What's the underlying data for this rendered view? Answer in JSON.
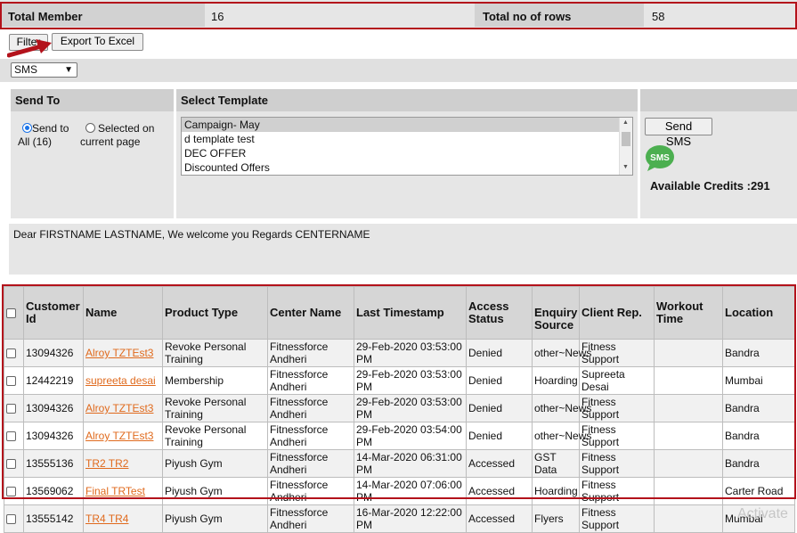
{
  "summary": {
    "total_member_label": "Total Member",
    "total_member_value": "16",
    "total_rows_label": "Total no of rows",
    "total_rows_value": "58"
  },
  "toolbar": {
    "filter_label": "Filter",
    "export_label": "Export To Excel"
  },
  "channel_select": {
    "value": "SMS"
  },
  "send_to": {
    "heading": "Send To",
    "option_all": "Send to All (16)",
    "option_selected": "Selected on current page",
    "selected": "all"
  },
  "template": {
    "heading": "Select Template",
    "options": [
      "Campaign- May",
      "d template test",
      "DEC OFFER",
      "Discounted Offers"
    ],
    "selected_index": 0
  },
  "sms_panel": {
    "send_label": "Send SMS",
    "icon_text": "SMS",
    "credits": "Available Credits :291"
  },
  "message": {
    "text": "Dear FIRSTNAME LASTNAME, We welcome you Regards CENTERNAME"
  },
  "table": {
    "headers": [
      "Customer Id",
      "Name",
      "Product Type",
      "Center Name",
      "Last Timestamp",
      "Access Status",
      "Enquiry Source",
      "Client Rep.",
      "Workout Time",
      "Location"
    ],
    "rows": [
      {
        "id": "13094326",
        "name": "Alroy TZTEst3",
        "product": "Revoke Personal Training",
        "center": "Fitnessforce Andheri",
        "timestamp": "29-Feb-2020 03:53:00 PM",
        "access": "Denied",
        "enquiry": "other~News",
        "rep": "Fitness Support",
        "workout": "",
        "location": "Bandra"
      },
      {
        "id": "12442219",
        "name": "supreeta desai",
        "product": "Membership",
        "center": "Fitnessforce Andheri",
        "timestamp": "29-Feb-2020 03:53:00 PM",
        "access": "Denied",
        "enquiry": "Hoarding",
        "rep": "Supreeta Desai",
        "workout": "",
        "location": "Mumbai"
      },
      {
        "id": "13094326",
        "name": "Alroy TZTEst3",
        "product": "Revoke Personal Training",
        "center": "Fitnessforce Andheri",
        "timestamp": "29-Feb-2020 03:53:00 PM",
        "access": "Denied",
        "enquiry": "other~News",
        "rep": "Fitness Support",
        "workout": "",
        "location": "Bandra"
      },
      {
        "id": "13094326",
        "name": "Alroy TZTEst3",
        "product": "Revoke Personal Training",
        "center": "Fitnessforce Andheri",
        "timestamp": "29-Feb-2020 03:54:00 PM",
        "access": "Denied",
        "enquiry": "other~News",
        "rep": "Fitness Support",
        "workout": "",
        "location": "Bandra"
      },
      {
        "id": "13555136",
        "name": "TR2 TR2",
        "product": "Piyush Gym",
        "center": "Fitnessforce Andheri",
        "timestamp": "14-Mar-2020 06:31:00 PM",
        "access": "Accessed",
        "enquiry": "GST Data",
        "rep": "Fitness Support",
        "workout": "",
        "location": "Bandra"
      },
      {
        "id": "13569062",
        "name": "Final TRTest",
        "product": "Piyush Gym",
        "center": "Fitnessforce Andheri",
        "timestamp": "14-Mar-2020 07:06:00 PM",
        "access": "Accessed",
        "enquiry": "Hoarding",
        "rep": "Fitness Support",
        "workout": "",
        "location": "Carter Road"
      },
      {
        "id": "13555142",
        "name": "TR4 TR4",
        "product": "Piyush Gym",
        "center": "Fitnessforce Andheri",
        "timestamp": "16-Mar-2020 12:22:00 PM",
        "access": "Accessed",
        "enquiry": "Flyers",
        "rep": "Fitness Support",
        "workout": "",
        "location": "Mumbai"
      }
    ]
  },
  "watermark": "Activate",
  "colors": {
    "highlight_red": "#b3121b",
    "link": "#e06a1d",
    "sms_green": "#4caf50"
  }
}
